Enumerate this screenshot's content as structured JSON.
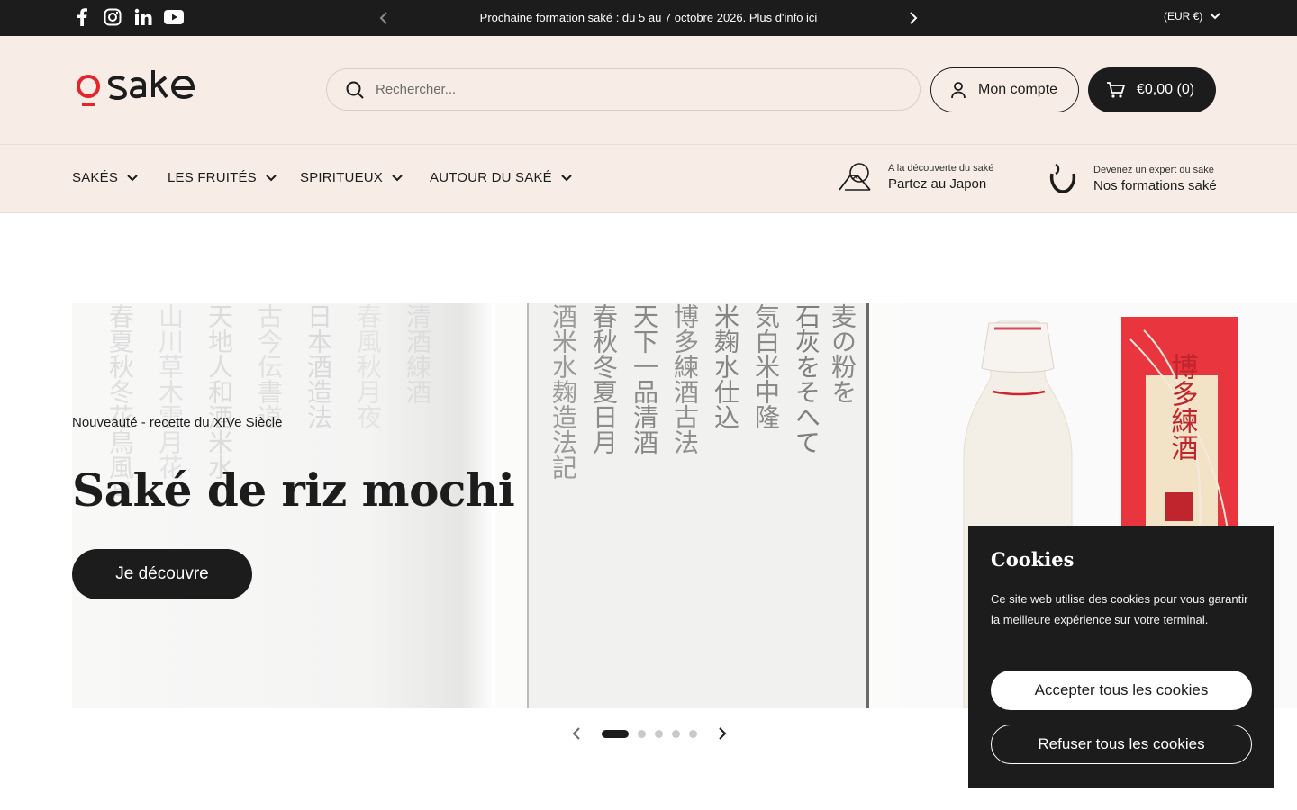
{
  "topbar": {
    "social": [
      "facebook-icon",
      "instagram-icon",
      "linkedin-icon",
      "youtube-icon"
    ],
    "announcement": "Prochaine formation saké : du 5 au 7 octobre 2026. Plus d'info ici",
    "currency": "(EUR €)"
  },
  "header": {
    "logo": "osake",
    "search_placeholder": "Rechercher...",
    "account_label": "Mon compte",
    "cart_label": "€0,00 (0)"
  },
  "nav": {
    "items": [
      {
        "label": "SAKÉS"
      },
      {
        "label": "LES FRUITÉS"
      },
      {
        "label": "SPIRITUEUX"
      },
      {
        "label": "AUTOUR DU SAKÉ"
      }
    ],
    "promos": [
      {
        "small": "A la découverte du saké",
        "big": "Partez au Japon"
      },
      {
        "small": "Devenez un expert du saké",
        "big": "Nos formations saké"
      }
    ]
  },
  "hero": {
    "kicker": "Nouveauté - recette du XIVe Siècle",
    "title": "Saké de riz mochi",
    "cta": "Je découvre",
    "label_text": "博多練酒",
    "slide_count": 5,
    "active_slide": 1
  },
  "cookie": {
    "title": "Cookies",
    "text": "Ce site web utilise des cookies pour vous garantir la meilleure expérience sur votre terminal.",
    "accept": "Accepter tous les cookies",
    "refuse": "Refuser tous les cookies"
  },
  "colors": {
    "dark": "#1c1c1c",
    "header_bg": "#f7ede6",
    "brand_red": "#e3262b"
  }
}
